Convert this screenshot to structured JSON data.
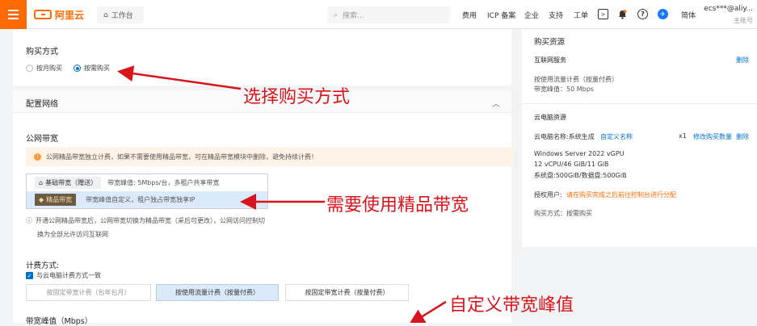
{
  "header": {
    "logo_text": "阿里云",
    "workbench_label": "工作台",
    "search_placeholder": "搜索...",
    "nav": [
      "费用",
      "ICP 备案",
      "企业",
      "支持",
      "工单"
    ],
    "lang": "简体",
    "user_name": "ecs***@aliy...",
    "user_role": "主账号"
  },
  "purchase": {
    "title": "购买方式",
    "options": [
      "按月购买",
      "按需购买"
    ],
    "selected_index": 1
  },
  "network": {
    "title": "配置网络",
    "public_bw_title": "公网带宽",
    "notice": "公网精品带宽独立计费，如果不需要使用精品带宽，可在精品带宽模块中删除，避免持续计费！",
    "bw_options": [
      {
        "tag": "基础带宽（赠送）",
        "desc": "带宽峰值: 5Mbps/台，多租户共享带宽"
      },
      {
        "tag": "精品带宽",
        "desc": "带宽峰值自定义，租户独占带宽独享IP"
      }
    ],
    "info_line1": "开通公网精品带宽后，公网带宽切换为精品带宽（采后可更改），公网访问控制切",
    "info_line2": "换为全部允许访问互联网",
    "billing_title": "计费方式:",
    "billing_check": "与云电脑计费方式一致",
    "billing_options": [
      "按固定带宽计费（包年包月）",
      "按使用流量计费（按量付费）",
      "按固定带宽计费（按量付费）"
    ],
    "peak_title": "带宽峰值（Mbps）"
  },
  "resources": {
    "title": "购买资源",
    "internet_title": "互联网服务",
    "delete_label": "删除",
    "internet_line1": "按使用流量计费（按量付费）",
    "internet_line2": "带宽峰值：50 Mbps",
    "cloud_title": "云电脑资源",
    "cloud_name_label": "云电脑名称:系统生成",
    "custom_name_link": "自定义名称",
    "count": "x1",
    "modify_count_link": "修改购买数量",
    "spec_line1": "Windows Server 2022 vGPU",
    "spec_line2": "12 vCPU/46 GiB/11 GiB",
    "spec_line3": "系统盘:500GiB/数据盘:500GiB",
    "auth_label": "授权用户:",
    "auth_value": "请在购买完成之后前往控制台进行分配",
    "pay_method": "购买方式：按需购买"
  },
  "annotations": [
    "选择购买方式",
    "需要使用精品带宽",
    "自定义带宽峰值"
  ],
  "colors": {
    "accent": "#ff6a00",
    "link": "#0070cc",
    "annotation": "#d9141b"
  }
}
